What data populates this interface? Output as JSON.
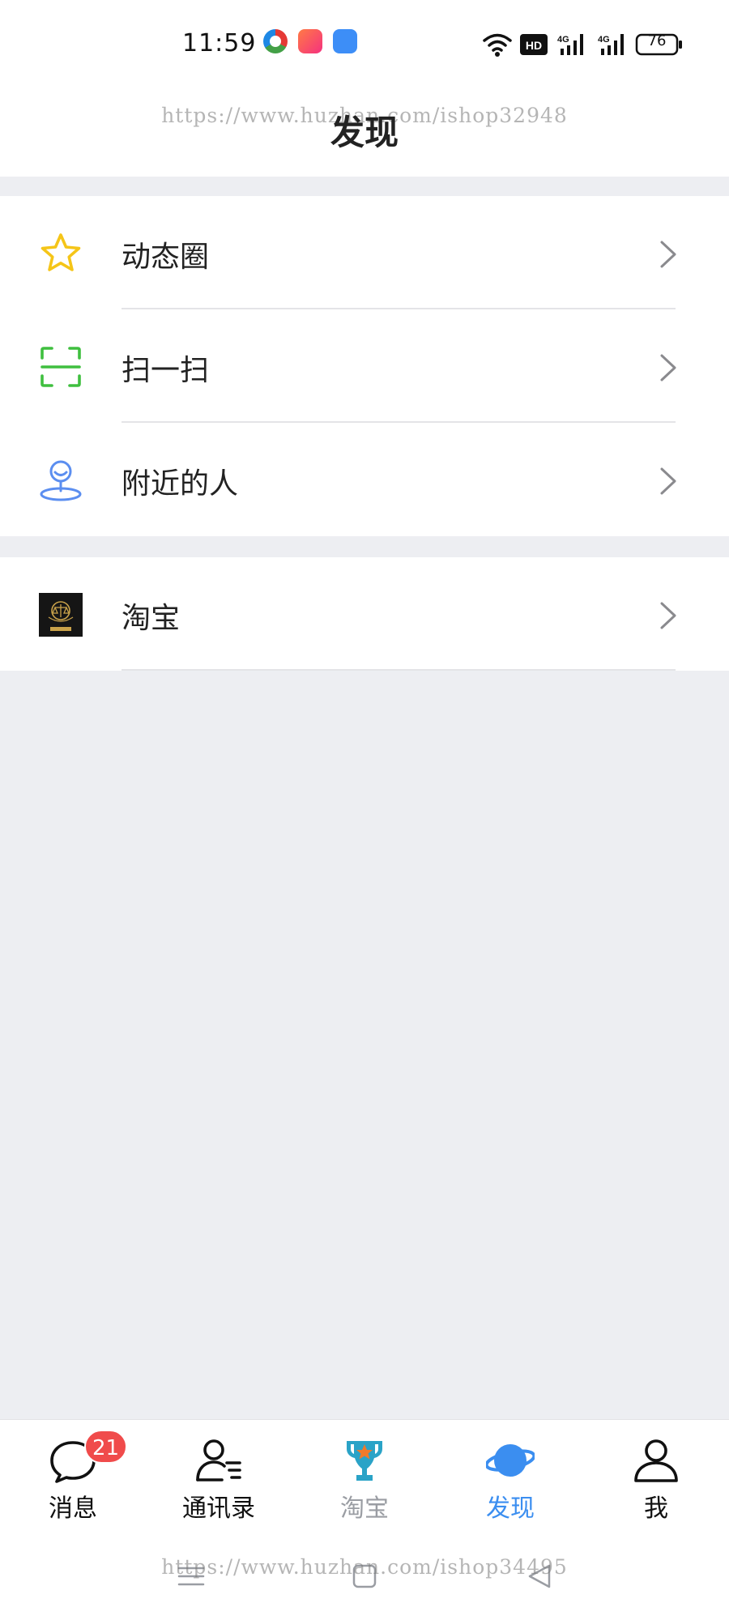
{
  "status_bar": {
    "time": "11:59",
    "battery": "76",
    "network": [
      "wifi-icon",
      "hd-icon",
      "4g-signal-icon",
      "4g-signal-icon"
    ]
  },
  "watermark": {
    "top": "https://www.huzhan.com/ishop32948",
    "bottom": "https://www.huzhan.com/ishop34495"
  },
  "header": {
    "title": "发现"
  },
  "groups": [
    {
      "items": [
        {
          "label": "动态圈",
          "icon": "star-icon",
          "color": "#f5c518"
        },
        {
          "label": "扫一扫",
          "icon": "scan-icon",
          "color": "#3fbf3f"
        },
        {
          "label": "附近的人",
          "icon": "nearby-person-icon",
          "color": "#5b8ef0"
        }
      ]
    },
    {
      "items": [
        {
          "label": "淘宝",
          "icon": "taobao-logo"
        }
      ]
    }
  ],
  "tabs": [
    {
      "label": "消息",
      "icon": "chat-bubble-icon",
      "badge": "21"
    },
    {
      "label": "通讯录",
      "icon": "contacts-icon"
    },
    {
      "label": "淘宝",
      "icon": "trophy-icon"
    },
    {
      "label": "发现",
      "icon": "planet-icon",
      "active": true
    },
    {
      "label": "我",
      "icon": "person-icon"
    }
  ],
  "colors": {
    "accent": "#3b8ef0",
    "badge": "#f04b4b",
    "background": "#edeef2"
  }
}
